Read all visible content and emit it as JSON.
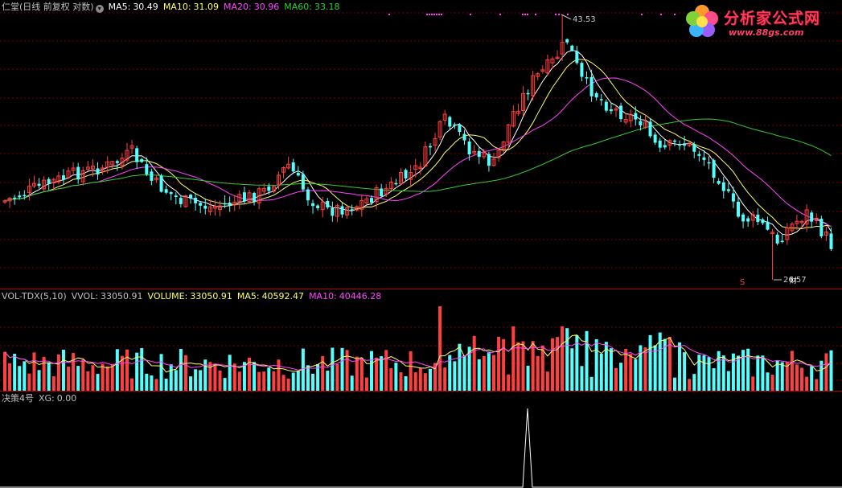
{
  "main_panel": {
    "title": "仁堂(日线 前复权 对数)",
    "dropdown_icon": "chevron-down-circle-icon",
    "indicators": [
      {
        "label": "MA5:",
        "value": "30.49",
        "color": "#ffffff"
      },
      {
        "label": "MA10:",
        "value": "31.09",
        "color": "#ffff66"
      },
      {
        "label": "MA20:",
        "value": "30.96",
        "color": "#ff44ff"
      },
      {
        "label": "MA60:",
        "value": "33.18",
        "color": "#33cc33"
      }
    ],
    "high_label": "43.53",
    "low_label": "26.57",
    "marker_s": "S",
    "marker_cai": "财"
  },
  "volume_panel": {
    "title": "VOL-TDX(5,10)",
    "indicators": [
      {
        "label": "VVOL:",
        "value": "33050.91",
        "color": "#c0c0c0"
      },
      {
        "label": "VOLUME:",
        "value": "33050.91",
        "color": "#ffff66"
      },
      {
        "label": "MA5:",
        "value": "40592.47",
        "color": "#ffff66"
      },
      {
        "label": "MA10:",
        "value": "40446.28",
        "color": "#ff44ff"
      }
    ]
  },
  "indicator_panel": {
    "title": "决策4号",
    "indicators": [
      {
        "label": "XG:",
        "value": "0.00",
        "color": "#c0c0c0"
      }
    ]
  },
  "logo": {
    "title": "分析家公式网",
    "url": "www.88gs.com",
    "icon": "flower-logo-icon"
  },
  "colors": {
    "up": "#ff4040",
    "down": "#54ffff",
    "ma5": "#ffffff",
    "ma10": "#ffff66",
    "ma20": "#ff44ff",
    "ma60": "#33cc33",
    "grid": "#7a0000",
    "divider": "#b00000"
  }
}
